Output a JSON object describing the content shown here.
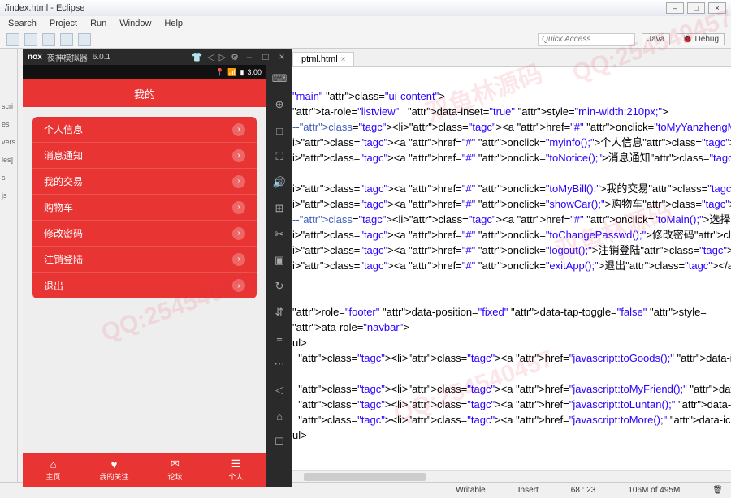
{
  "window": {
    "title": "/index.html - Eclipse"
  },
  "menubar": [
    "Search",
    "Project",
    "Run",
    "Window",
    "Help"
  ],
  "quick_access": {
    "placeholder": "Quick Access"
  },
  "perspectives": {
    "java": "Java",
    "debug": "Debug"
  },
  "nox": {
    "title": "夜神模拟器",
    "version": "6.0.1",
    "status_time": "3:00",
    "app_title": "我的",
    "menu_items": [
      {
        "label": "个人信息"
      },
      {
        "label": "消息通知"
      },
      {
        "label": "我的交易"
      },
      {
        "label": "购物车"
      },
      {
        "label": "修改密码"
      },
      {
        "label": "注销登陆"
      },
      {
        "label": "退出"
      }
    ],
    "footer": [
      {
        "icon": "⌂",
        "label": "主页"
      },
      {
        "icon": "♥",
        "label": "我的关注"
      },
      {
        "icon": "✉",
        "label": "论坛"
      },
      {
        "icon": "☰",
        "label": "个人"
      }
    ]
  },
  "editor": {
    "tab": "ptml.html",
    "lines": [
      "",
      "\"main\" class=\"ui-content\">",
      "ta-role=\"listview\"   data-inset=\"true\" style=\"min-width:210px;\">",
      "--<li><a href=\"#\" onclick=\"toMyYanzhengMessage();\">关注验证</a></li>--",
      "i><a href=\"#\" onclick=\"myinfo();\">个人信息</a></li>",
      "i><a href=\"#\" onclick=\"toNotice();\">消息通知</a></li>",
      "",
      "i><a href=\"#\" onclick=\"toMyBill();\">我的交易</a></li>",
      "i><a href=\"#\" onclick=\"showCar();\">购物车</a></li>",
      "--<li><a href=\"#\" onclick=\"toMain();\">选择城市</a></li>-->",
      "i><a href=\"#\" onclick=\"toChangePasswd();\">修改密码</a></li>",
      "i><a href=\"#\" onclick=\"logout();\">注销登陆</a></li>",
      "i><a href=\"#\" onclick=\"exitApp();\">退出</a></li>",
      "",
      "",
      "role=\"footer\" data-position=\"fixed\" data-tap-toggle=\"false\" style=",
      "ata-role=\"navbar\">",
      "ul>",
      "  <li><a href=\"javascript:toGoods();\" data-icon=\"home\">主页</a></li",
      "",
      "  <li><a href=\"javascript:toMyFriend();\" data-icon=\"user\">我的关注</",
      "  <li><a href=\"javascript:toLuntan();\" data-icon=\"comment\">论坛</a>",
      "  <li><a href=\"javascript:toMore();\" data-icon=\"info\">个人</a></li>",
      "ul>"
    ]
  },
  "statusbar": {
    "writable": "Writable",
    "insert": "Insert",
    "pos": "68 : 23",
    "heap": "106M of 495M"
  },
  "left_labels": [
    "scri",
    "es",
    "vers",
    "les]",
    "s",
    "js"
  ],
  "watermarks": [
    "QQ:254540457",
    "双鱼林源码",
    "汪建林"
  ]
}
